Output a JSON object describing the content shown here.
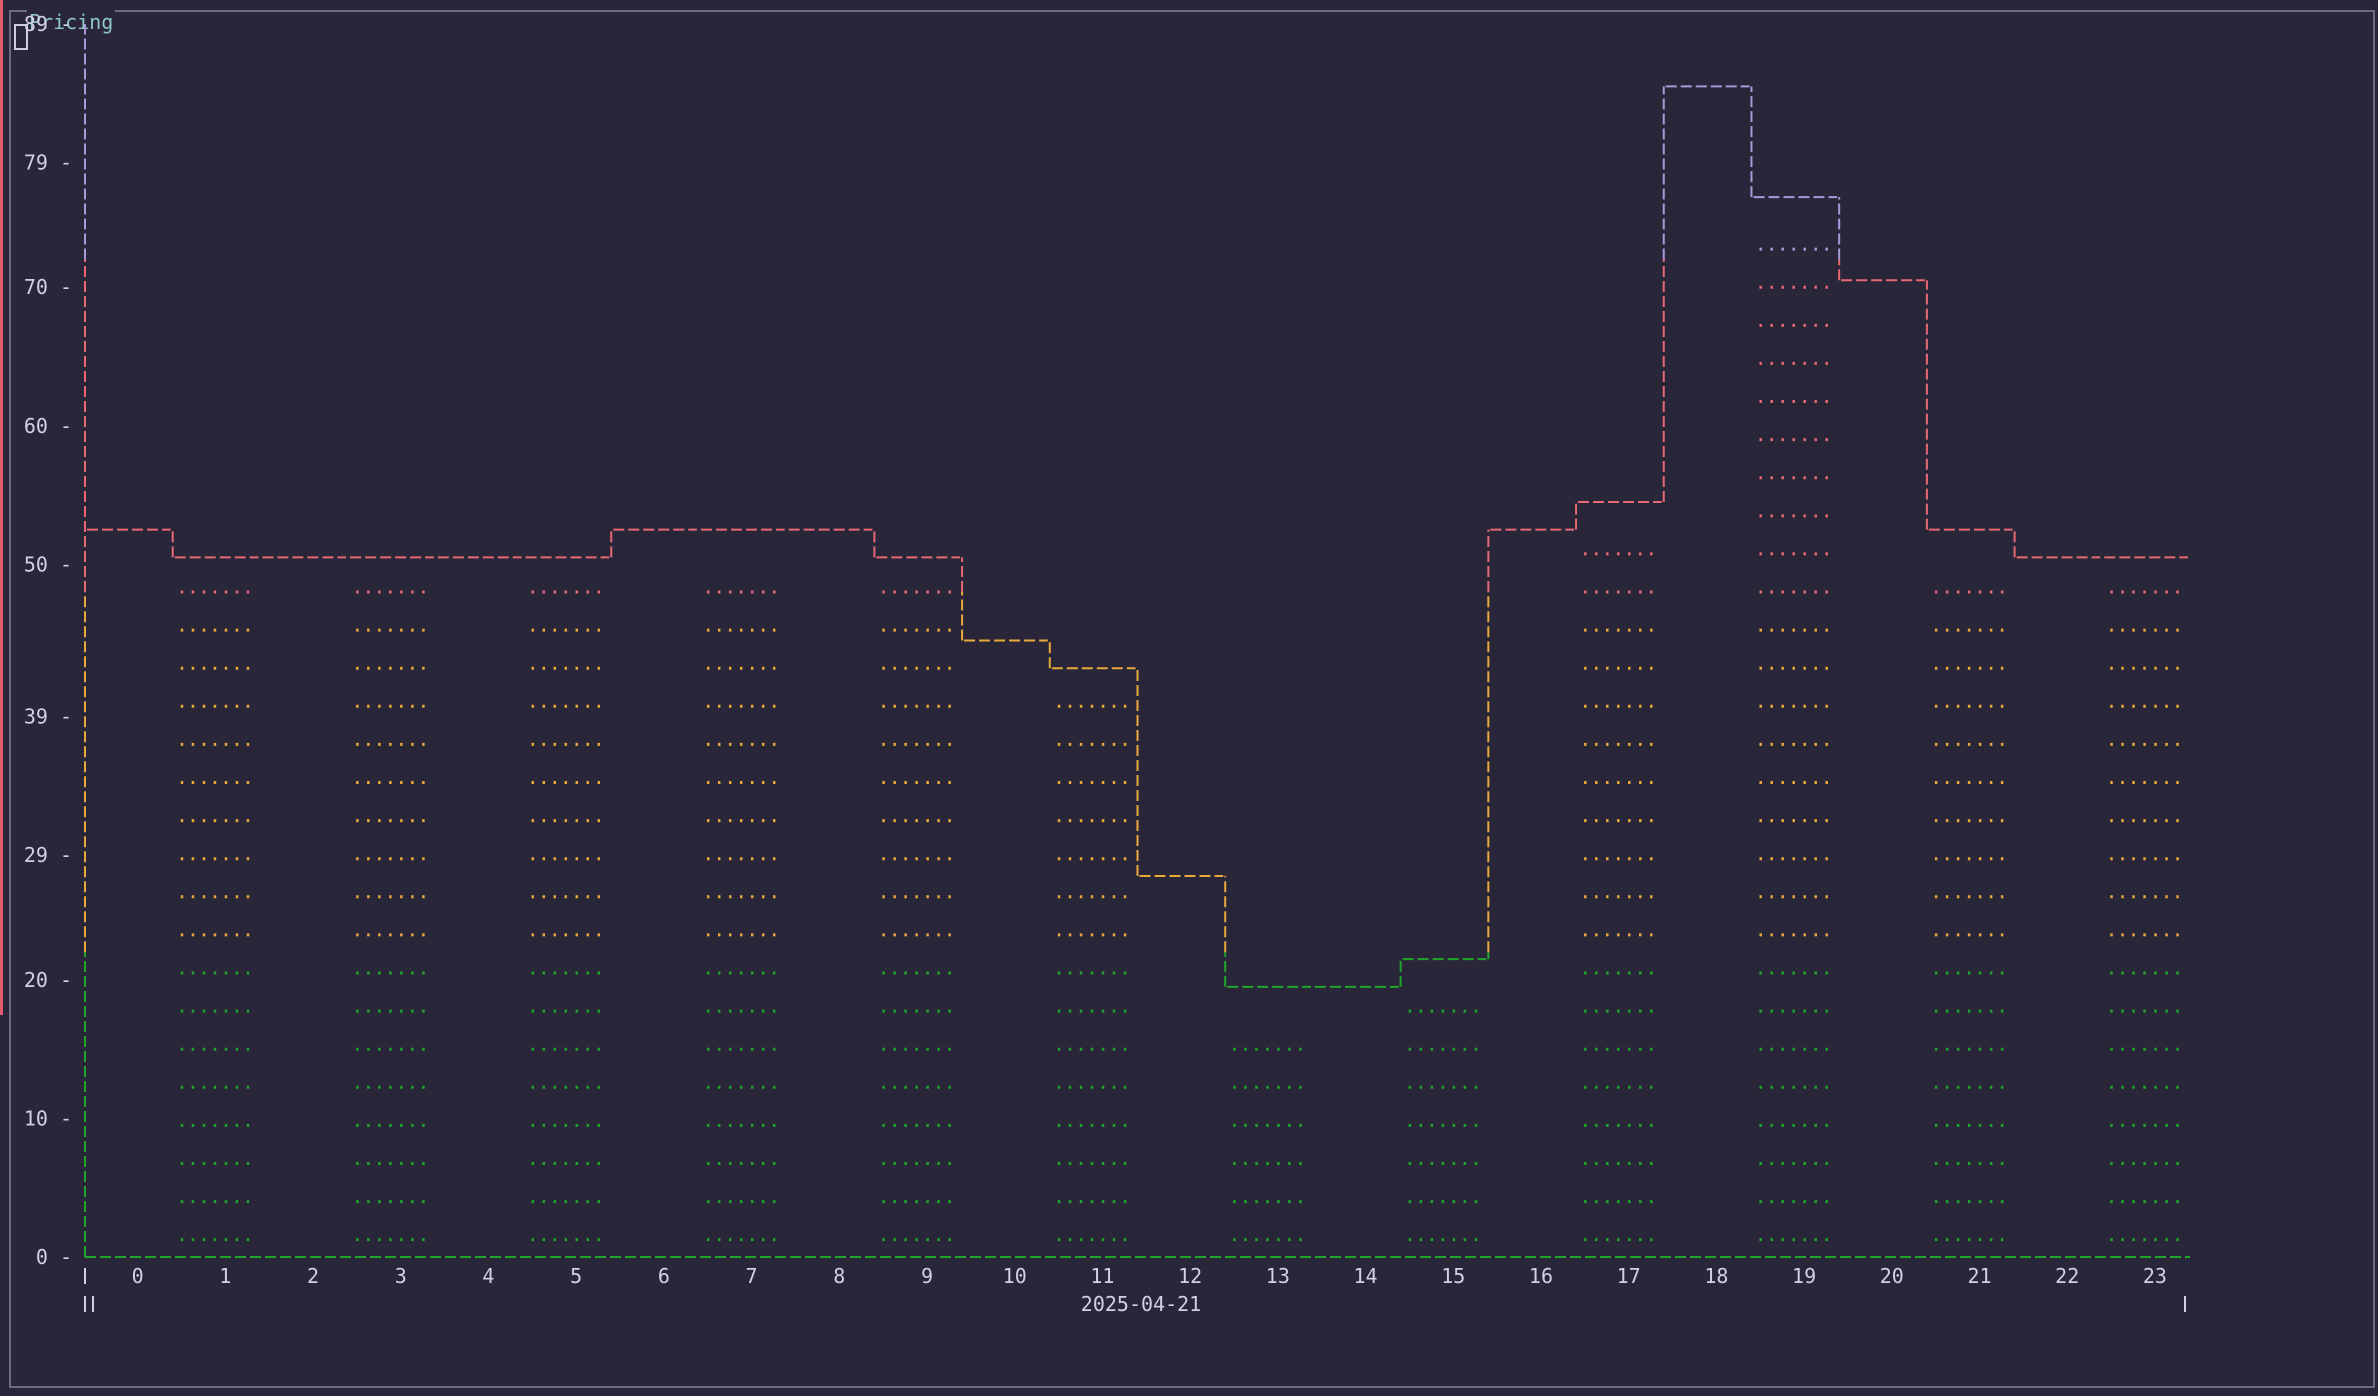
{
  "panel": {
    "title": "Pricing"
  },
  "colors": {
    "background": "#292639",
    "border": "#6e6a86",
    "title": "#8fc6c9",
    "axis_text": "#d4d0e4",
    "low": "#1fa62a",
    "mid": "#e9a93a",
    "high": "#e86874",
    "peak": "#a79ad9"
  },
  "chart_data": {
    "type": "bar",
    "title": "Pricing",
    "xlabel": "2025-04-21",
    "ylabel": "",
    "ylim": [
      0,
      89
    ],
    "y_ticks": [
      "0",
      "10",
      "20",
      "29",
      "39",
      "50",
      "60",
      "70",
      "79",
      "89"
    ],
    "categories": [
      "0",
      "1",
      "2",
      "3",
      "4",
      "5",
      "6",
      "7",
      "8",
      "9",
      "10",
      "11",
      "12",
      "13",
      "14",
      "15",
      "16",
      "17",
      "18",
      "19",
      "20",
      "21",
      "22",
      "23"
    ],
    "values": [
      52.5,
      50.5,
      50.5,
      50.5,
      50.5,
      50.5,
      52.5,
      52.5,
      52.5,
      50.5,
      44.5,
      42.5,
      27.5,
      19.5,
      19.5,
      21.5,
      52.5,
      54.5,
      84.5,
      76.5,
      70.5,
      52.5,
      50.5,
      50.5
    ],
    "color_bands": [
      {
        "from": 0,
        "to": 22,
        "color": "#1fa62a"
      },
      {
        "from": 22,
        "to": 48,
        "color": "#e9a93a"
      },
      {
        "from": 48,
        "to": 72,
        "color": "#e86874"
      },
      {
        "from": 72,
        "to": 89,
        "color": "#a79ad9"
      }
    ],
    "grid": false,
    "legend": "none"
  }
}
